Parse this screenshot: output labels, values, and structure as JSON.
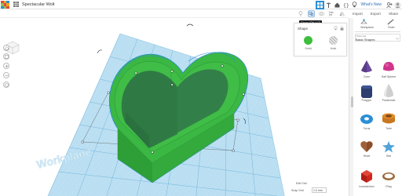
{
  "app": {
    "logo_colors": [
      "#e34a3c",
      "#f4a524",
      "#2d8fd5",
      "#8bc34a",
      "#e34a3c",
      "#f4a524",
      "#2d8fd5",
      "#8bc34a",
      "#e34a3c"
    ],
    "project_title": "Spectacular Wolt"
  },
  "topbar": {
    "whats_new": "What's New",
    "accent": "#2d8fd5"
  },
  "subbar": {
    "import": "Import",
    "export": "Export",
    "share": "Share"
  },
  "tooltip": {
    "text": "Group (Ctrl + G)"
  },
  "shape_panel": {
    "title": "Shape",
    "solid_label": "Solid",
    "hole_label": "Hole",
    "solid_color": "#3dbf3d"
  },
  "workplane": {
    "label": "Workplane",
    "edit_grid": "Edit Grid",
    "snap_grid_label": "Snap Grid",
    "snap_grid_value": "1.0 mm"
  },
  "sidebar": {
    "workplane_tab": "Workplane",
    "ruler_tab": "Ruler",
    "library_label": "Tinkercad",
    "library_value": "Basic Shapes",
    "shapes": [
      {
        "label": "Cone",
        "icon": "cone-icon",
        "color": "#6a4a9e"
      },
      {
        "label": "Half Sphere",
        "icon": "half-sphere-icon",
        "color": "#d1348a"
      },
      {
        "label": "Polygon",
        "icon": "polygon-icon",
        "color": "#2c3f6e"
      },
      {
        "label": "Paraboloid",
        "icon": "paraboloid-icon",
        "color": "#cfcfcf"
      },
      {
        "label": "Torus",
        "icon": "torus-icon",
        "color": "#2b8fd6"
      },
      {
        "label": "Tube",
        "icon": "tube-icon",
        "color": "#e28a2a"
      },
      {
        "label": "Heart",
        "icon": "heart-icon",
        "color": "#8a4d2a"
      },
      {
        "label": "Star",
        "icon": "star-icon",
        "color": "#4fa3d8"
      },
      {
        "label": "Icosahedron",
        "icon": "icosahedron-icon",
        "color": "#d0281e"
      },
      {
        "label": "Ring",
        "icon": "ring-icon",
        "color": "#9a6a3a"
      }
    ]
  }
}
